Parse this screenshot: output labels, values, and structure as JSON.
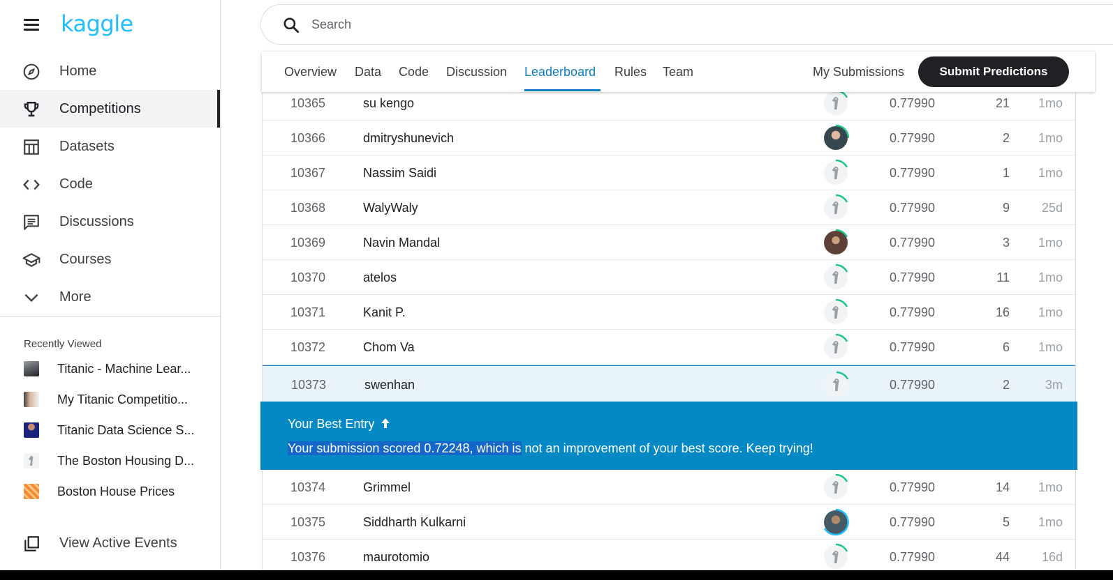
{
  "app": {
    "logo": "kaggle"
  },
  "search": {
    "placeholder": "Search"
  },
  "nav": [
    {
      "label": "Home",
      "icon": "compass-icon",
      "active": false
    },
    {
      "label": "Competitions",
      "icon": "trophy-icon",
      "active": true
    },
    {
      "label": "Datasets",
      "icon": "table-icon",
      "active": false
    },
    {
      "label": "Code",
      "icon": "code-icon",
      "active": false
    },
    {
      "label": "Discussions",
      "icon": "comment-icon",
      "active": false
    },
    {
      "label": "Courses",
      "icon": "school-icon",
      "active": false
    },
    {
      "label": "More",
      "icon": "chevron-down-icon",
      "active": false
    }
  ],
  "recent": {
    "heading": "Recently Viewed",
    "items": [
      {
        "label": "Titanic - Machine Lear..."
      },
      {
        "label": "My Titanic Competitio..."
      },
      {
        "label": "Titanic Data Science S..."
      },
      {
        "label": "The Boston Housing D..."
      },
      {
        "label": "Boston House Prices"
      }
    ]
  },
  "active_events": {
    "label": "View Active Events"
  },
  "tabs": [
    {
      "label": "Overview"
    },
    {
      "label": "Data"
    },
    {
      "label": "Code"
    },
    {
      "label": "Discussion"
    },
    {
      "label": "Leaderboard",
      "active": true
    },
    {
      "label": "Rules"
    },
    {
      "label": "Team"
    }
  ],
  "header": {
    "my_submissions": "My Submissions",
    "submit_label": "Submit Predictions"
  },
  "leaderboard": {
    "rows_top": [
      {
        "rank": "10365",
        "team": "su kengo",
        "score": "0.77990",
        "entries": "21",
        "last": "1mo"
      },
      {
        "rank": "10366",
        "team": "dmitryshunevich",
        "score": "0.77990",
        "entries": "2",
        "last": "1mo"
      },
      {
        "rank": "10367",
        "team": "Nassim Saidi",
        "score": "0.77990",
        "entries": "1",
        "last": "1mo"
      },
      {
        "rank": "10368",
        "team": "WalyWaly",
        "score": "0.77990",
        "entries": "9",
        "last": "25d"
      },
      {
        "rank": "10369",
        "team": "Navin Mandal",
        "score": "0.77990",
        "entries": "3",
        "last": "1mo"
      },
      {
        "rank": "10370",
        "team": "atelos",
        "score": "0.77990",
        "entries": "11",
        "last": "1mo"
      },
      {
        "rank": "10371",
        "team": "Kanit P.",
        "score": "0.77990",
        "entries": "16",
        "last": "1mo"
      },
      {
        "rank": "10372",
        "team": "Chom Va",
        "score": "0.77990",
        "entries": "6",
        "last": "1mo"
      }
    ],
    "selected_row": {
      "rank": "10373",
      "team": "swenhan",
      "score": "0.77990",
      "entries": "2",
      "last": "3m"
    },
    "rows_bottom": [
      {
        "rank": "10374",
        "team": "Grimmel",
        "score": "0.77990",
        "entries": "14",
        "last": "1mo"
      },
      {
        "rank": "10375",
        "team": "Siddharth Kulkarni",
        "score": "0.77990",
        "entries": "5",
        "last": "1mo"
      },
      {
        "rank": "10376",
        "team": "maurotomio",
        "score": "0.77990",
        "entries": "44",
        "last": "16d"
      }
    ]
  },
  "best_entry": {
    "title": "Your Best Entry",
    "message_highlighted": "Your submission scored 0.72248, which is",
    "message_rest": " not an improvement of your best score. Keep trying!"
  },
  "colors": {
    "brand": "#20beff",
    "accent": "#0f7cbf",
    "banner": "#0589c5",
    "ring": "#1ec38b"
  }
}
